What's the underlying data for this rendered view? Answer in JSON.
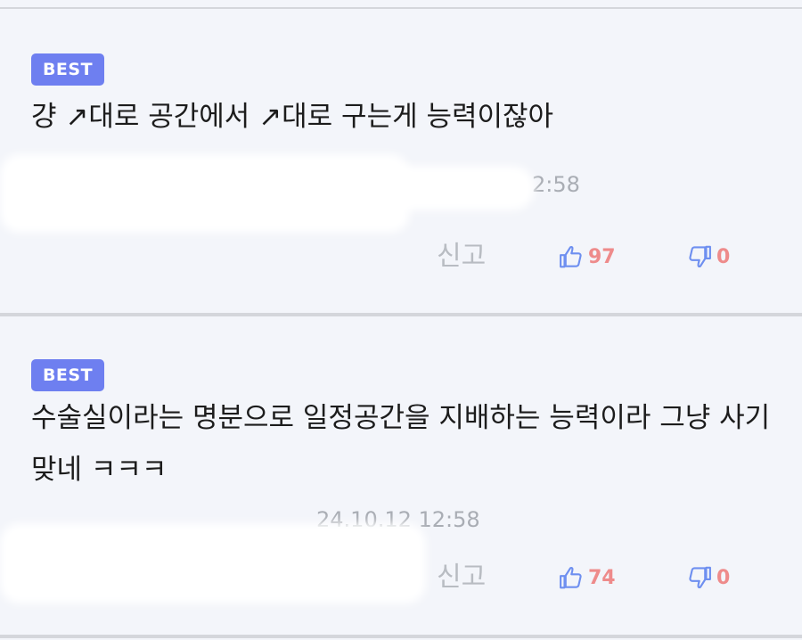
{
  "comments": [
    {
      "badge": "BEST",
      "text": "걍 ↗대로 공간에서 ↗대로 구는게 능력이잖아",
      "meta": "2:58",
      "report_label": "신고",
      "likes": "97",
      "dislikes": "0"
    },
    {
      "badge": "BEST",
      "text": "수술실이라는 명분으로 일정공간을 지배하는 능력이라 그냥 사기 맞네 ㅋㅋㅋ",
      "meta": "24.10.12 12:58",
      "report_label": "신고",
      "likes": "74",
      "dislikes": "0"
    }
  ],
  "icons": {
    "like": "thumbs-up-icon",
    "dislike": "thumbs-down-icon"
  },
  "colors": {
    "badge_bg": "#6e7ff0",
    "icon_blue": "#6e8ff0",
    "count_red": "#ee8b8b",
    "report_gray": "#b8bcc2",
    "background": "#f3f5fa"
  }
}
